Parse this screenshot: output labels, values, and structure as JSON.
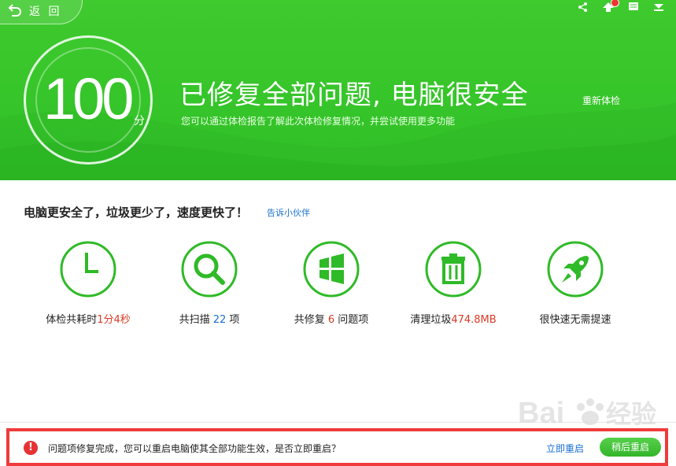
{
  "header": {
    "back_label": "返 回",
    "score": "100",
    "score_unit": "分",
    "headline": "已修复全部问题, 电脑很安全",
    "subline": "您可以通过体检报告了解此次体检修复情况，并尝试使用更多功能",
    "recheck_label": "重新体检",
    "colors": {
      "green": "#3fca2e",
      "white": "#ffffff"
    }
  },
  "summary": {
    "title": "电脑更安全了，垃圾更少了，速度更快了！",
    "share_link": "告诉小伙伴"
  },
  "stats": [
    {
      "icon": "clock-icon",
      "prefix": "体检共耗时",
      "value": "1分4秒",
      "suffix": ""
    },
    {
      "icon": "magnifier-icon",
      "prefix": "共扫描 ",
      "value": "22",
      "suffix": " 项"
    },
    {
      "icon": "windows-icon",
      "prefix": "共修复 ",
      "value": "6",
      "suffix": " 问题项"
    },
    {
      "icon": "trash-icon",
      "prefix": "清理垃圾",
      "value": "474.8MB",
      "suffix": ""
    },
    {
      "icon": "rocket-icon",
      "prefix": "很快速无需提速",
      "value": "",
      "suffix": ""
    }
  ],
  "notice": {
    "icon": "!",
    "text": "问题项修复完成，您可以重启电脑使其全部功能生效，是否立即重启？",
    "restart_now": "立即重启",
    "restart_later": "稍后重启",
    "border_color": "#ef3b3b"
  },
  "watermark": {
    "text": "Baidu 经验"
  }
}
